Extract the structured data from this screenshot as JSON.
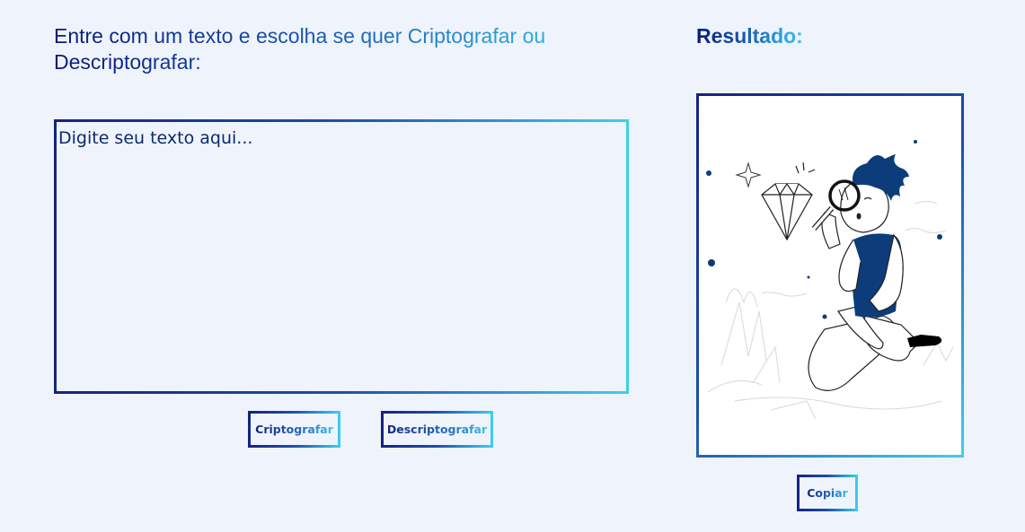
{
  "heading": {
    "text": "Entre com um texto e escolha se quer Criptografar ou Descriptografar:"
  },
  "input": {
    "placeholder": "Digite seu texto aqui...",
    "value": ""
  },
  "buttons": {
    "encrypt_label": "Criptografar",
    "decrypt_label": "Descriptografar",
    "copy_label": "Copiar"
  },
  "result": {
    "title": "Resultado:",
    "illustration": "person-with-magnifying-glass-inspecting-diamond"
  },
  "colors": {
    "background": "#eff3fc",
    "gradient_start": "#15237f",
    "gradient_end": "#3dd0ec",
    "illustration_accent": "#0d3c7a"
  }
}
